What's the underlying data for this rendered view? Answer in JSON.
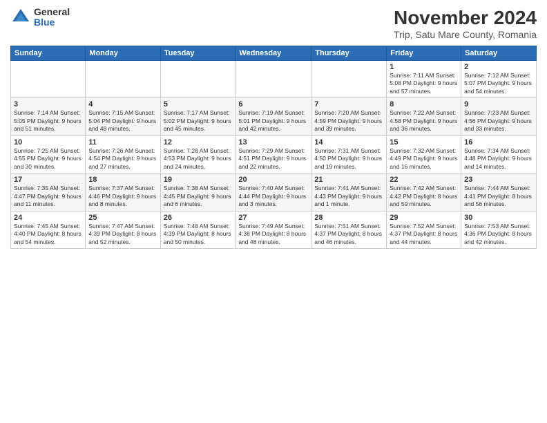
{
  "logo": {
    "general": "General",
    "blue": "Blue"
  },
  "title": "November 2024",
  "subtitle": "Trip, Satu Mare County, Romania",
  "days_of_week": [
    "Sunday",
    "Monday",
    "Tuesday",
    "Wednesday",
    "Thursday",
    "Friday",
    "Saturday"
  ],
  "weeks": [
    [
      {
        "day": "",
        "info": ""
      },
      {
        "day": "",
        "info": ""
      },
      {
        "day": "",
        "info": ""
      },
      {
        "day": "",
        "info": ""
      },
      {
        "day": "",
        "info": ""
      },
      {
        "day": "1",
        "info": "Sunrise: 7:11 AM\nSunset: 5:08 PM\nDaylight: 9 hours and 57 minutes."
      },
      {
        "day": "2",
        "info": "Sunrise: 7:12 AM\nSunset: 5:07 PM\nDaylight: 9 hours and 54 minutes."
      }
    ],
    [
      {
        "day": "3",
        "info": "Sunrise: 7:14 AM\nSunset: 5:05 PM\nDaylight: 9 hours and 51 minutes."
      },
      {
        "day": "4",
        "info": "Sunrise: 7:15 AM\nSunset: 5:04 PM\nDaylight: 9 hours and 48 minutes."
      },
      {
        "day": "5",
        "info": "Sunrise: 7:17 AM\nSunset: 5:02 PM\nDaylight: 9 hours and 45 minutes."
      },
      {
        "day": "6",
        "info": "Sunrise: 7:19 AM\nSunset: 5:01 PM\nDaylight: 9 hours and 42 minutes."
      },
      {
        "day": "7",
        "info": "Sunrise: 7:20 AM\nSunset: 4:59 PM\nDaylight: 9 hours and 39 minutes."
      },
      {
        "day": "8",
        "info": "Sunrise: 7:22 AM\nSunset: 4:58 PM\nDaylight: 9 hours and 36 minutes."
      },
      {
        "day": "9",
        "info": "Sunrise: 7:23 AM\nSunset: 4:56 PM\nDaylight: 9 hours and 33 minutes."
      }
    ],
    [
      {
        "day": "10",
        "info": "Sunrise: 7:25 AM\nSunset: 4:55 PM\nDaylight: 9 hours and 30 minutes."
      },
      {
        "day": "11",
        "info": "Sunrise: 7:26 AM\nSunset: 4:54 PM\nDaylight: 9 hours and 27 minutes."
      },
      {
        "day": "12",
        "info": "Sunrise: 7:28 AM\nSunset: 4:53 PM\nDaylight: 9 hours and 24 minutes."
      },
      {
        "day": "13",
        "info": "Sunrise: 7:29 AM\nSunset: 4:51 PM\nDaylight: 9 hours and 22 minutes."
      },
      {
        "day": "14",
        "info": "Sunrise: 7:31 AM\nSunset: 4:50 PM\nDaylight: 9 hours and 19 minutes."
      },
      {
        "day": "15",
        "info": "Sunrise: 7:32 AM\nSunset: 4:49 PM\nDaylight: 9 hours and 16 minutes."
      },
      {
        "day": "16",
        "info": "Sunrise: 7:34 AM\nSunset: 4:48 PM\nDaylight: 9 hours and 14 minutes."
      }
    ],
    [
      {
        "day": "17",
        "info": "Sunrise: 7:35 AM\nSunset: 4:47 PM\nDaylight: 9 hours and 11 minutes."
      },
      {
        "day": "18",
        "info": "Sunrise: 7:37 AM\nSunset: 4:46 PM\nDaylight: 9 hours and 8 minutes."
      },
      {
        "day": "19",
        "info": "Sunrise: 7:38 AM\nSunset: 4:45 PM\nDaylight: 9 hours and 6 minutes."
      },
      {
        "day": "20",
        "info": "Sunrise: 7:40 AM\nSunset: 4:44 PM\nDaylight: 9 hours and 3 minutes."
      },
      {
        "day": "21",
        "info": "Sunrise: 7:41 AM\nSunset: 4:43 PM\nDaylight: 9 hours and 1 minute."
      },
      {
        "day": "22",
        "info": "Sunrise: 7:42 AM\nSunset: 4:42 PM\nDaylight: 8 hours and 59 minutes."
      },
      {
        "day": "23",
        "info": "Sunrise: 7:44 AM\nSunset: 4:41 PM\nDaylight: 8 hours and 56 minutes."
      }
    ],
    [
      {
        "day": "24",
        "info": "Sunrise: 7:45 AM\nSunset: 4:40 PM\nDaylight: 8 hours and 54 minutes."
      },
      {
        "day": "25",
        "info": "Sunrise: 7:47 AM\nSunset: 4:39 PM\nDaylight: 8 hours and 52 minutes."
      },
      {
        "day": "26",
        "info": "Sunrise: 7:48 AM\nSunset: 4:39 PM\nDaylight: 8 hours and 50 minutes."
      },
      {
        "day": "27",
        "info": "Sunrise: 7:49 AM\nSunset: 4:38 PM\nDaylight: 8 hours and 48 minutes."
      },
      {
        "day": "28",
        "info": "Sunrise: 7:51 AM\nSunset: 4:37 PM\nDaylight: 8 hours and 46 minutes."
      },
      {
        "day": "29",
        "info": "Sunrise: 7:52 AM\nSunset: 4:37 PM\nDaylight: 8 hours and 44 minutes."
      },
      {
        "day": "30",
        "info": "Sunrise: 7:53 AM\nSunset: 4:36 PM\nDaylight: 8 hours and 42 minutes."
      }
    ]
  ]
}
